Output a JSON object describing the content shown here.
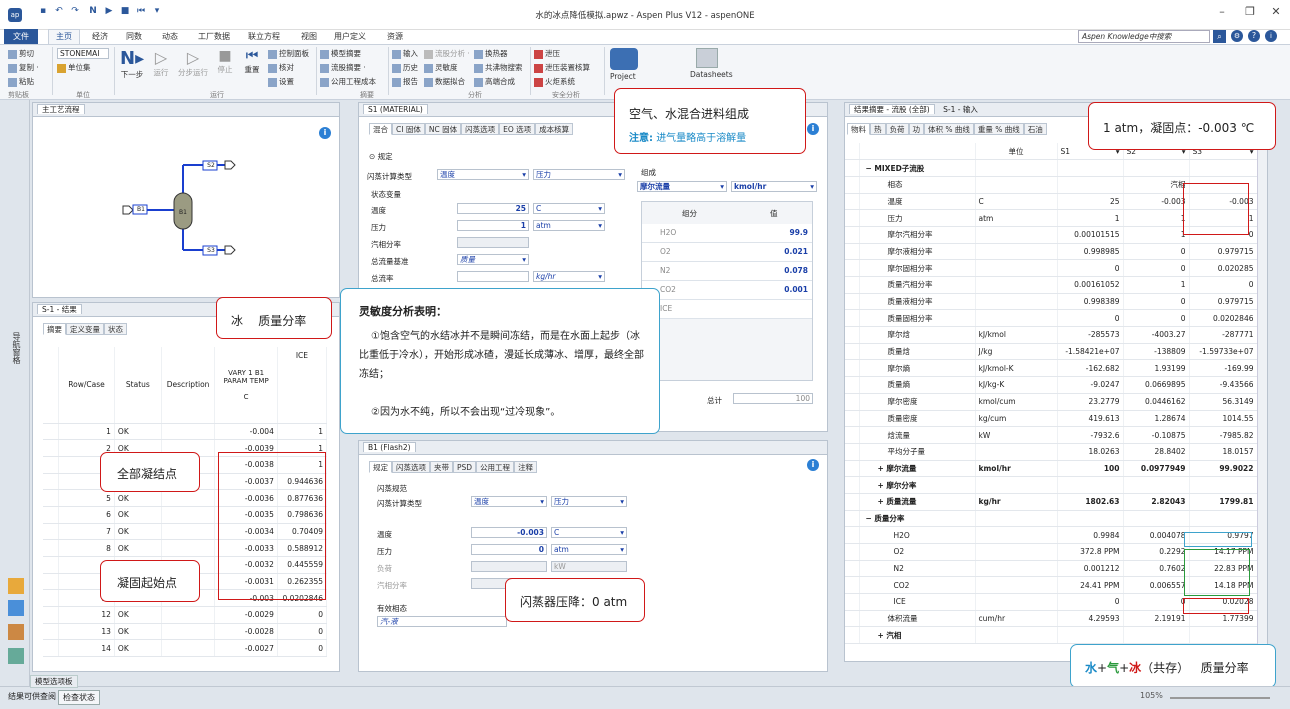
{
  "window": {
    "title": "水的冰点降低模拟.apwz - Aspen Plus V12 - aspenONE"
  },
  "menu": {
    "items": [
      "文件",
      "主页",
      "经济",
      "同数",
      "动态",
      "工厂数据",
      "联立方程",
      "视图",
      "用户定义",
      "资源"
    ],
    "search_placeholder": "Aspen Knowledge中搜索"
  },
  "ribbon": {
    "clipboard": {
      "cut": "剪切",
      "copy": "复制 ·",
      "paste": "粘贴",
      "label": "剪贴板"
    },
    "units": {
      "unit_set": "STONEMAI",
      "unit_btn": "单位集",
      "label": "单位"
    },
    "run": {
      "next": "下一步",
      "run": "运行",
      "step": "分步运行",
      "stop": "停止",
      "reset": "重置",
      "label": "运行"
    },
    "control": {
      "panel": "控制面板",
      "check": "核对",
      "settings": "设置"
    },
    "summary": {
      "model": "模型摘要",
      "stream": "流股摘要 ·",
      "utility": "公用工程成本",
      "label": "摘要"
    },
    "analysis": {
      "input": "输入",
      "history": "历史",
      "report": "报告",
      "stream_analysis": "流股分析 ·",
      "sensitivity": "灵敏度",
      "data_fit": "数据拟合",
      "hx": "换热器",
      "azeo": "共沸物搜索",
      "hydrate": "高端合成",
      "label": "分析"
    },
    "safety": {
      "relief": "泄压",
      "relief_check": "泄压装置核算",
      "flare": "火炬系统",
      "label": "安全分析"
    },
    "project": "Project",
    "datasheets": "Datasheets"
  },
  "flowsheet": {
    "tab": "主工艺流程",
    "streams": {
      "s1": "B1",
      "s2": "S2",
      "s3": "S3",
      "block": "B1"
    }
  },
  "sens": {
    "tab": "S-1 - 结果",
    "subtabs": [
      "摘要",
      "定义变量",
      "状态"
    ],
    "headers": {
      "row": "Row/Case",
      "status": "Status",
      "desc": "Description",
      "vary": "VARY 1 B1 PARAM TEMP",
      "vary_unit": "C",
      "ice": "ICE"
    },
    "rows": [
      {
        "n": "1",
        "s": "OK",
        "t": "-0.004",
        "ice": "1"
      },
      {
        "n": "2",
        "s": "OK",
        "t": "-0.0039",
        "ice": "1"
      },
      {
        "n": "3",
        "s": "OK",
        "t": "-0.0038",
        "ice": "1"
      },
      {
        "n": "4",
        "s": "OK",
        "t": "-0.0037",
        "ice": "0.944636"
      },
      {
        "n": "5",
        "s": "OK",
        "t": "-0.0036",
        "ice": "0.877636"
      },
      {
        "n": "6",
        "s": "OK",
        "t": "-0.0035",
        "ice": "0.798636"
      },
      {
        "n": "7",
        "s": "OK",
        "t": "-0.0034",
        "ice": "0.70409"
      },
      {
        "n": "8",
        "s": "OK",
        "t": "-0.0033",
        "ice": "0.588912"
      },
      {
        "n": "9",
        "s": "OK",
        "t": "-0.0032",
        "ice": "0.445559"
      },
      {
        "n": "10",
        "s": "OK",
        "t": "-0.0031",
        "ice": "0.262355"
      },
      {
        "n": "11",
        "s": "OK",
        "t": "-0.003",
        "ice": "0.0202846"
      },
      {
        "n": "12",
        "s": "OK",
        "t": "-0.0029",
        "ice": "0"
      },
      {
        "n": "13",
        "s": "OK",
        "t": "-0.0028",
        "ice": "0"
      },
      {
        "n": "14",
        "s": "OK",
        "t": "-0.0027",
        "ice": "0"
      }
    ]
  },
  "material": {
    "tab": "S1 (MATERIAL)",
    "subtabs": [
      "混合",
      "CI 固体",
      "NC 固体",
      "闪蒸选项",
      "EO 选项",
      "成本核算"
    ],
    "spec": "规定",
    "flash_type_label": "闪蒸计算类型",
    "flash_type": "温度",
    "flash_type2": "压力",
    "state_vars": "状态变量",
    "temp_label": "温度",
    "temp": "25",
    "temp_unit": "C",
    "pres_label": "压力",
    "pres": "1",
    "pres_unit": "atm",
    "vf_label": "汽相分率",
    "basis_label": "总流量基准",
    "basis": "质量",
    "rate_label": "总流率",
    "rate_unit": "kg/hr",
    "comp_label": "组成",
    "comp_basis": "摩尔流量",
    "comp_unit": "kmol/hr",
    "comp_hdr1": "组分",
    "comp_hdr2": "值",
    "comps": [
      {
        "c": "H2O",
        "v": "99.9"
      },
      {
        "c": "O2",
        "v": "0.021"
      },
      {
        "c": "N2",
        "v": "0.078"
      },
      {
        "c": "CO2",
        "v": "0.001"
      },
      {
        "c": "ICE",
        "v": ""
      }
    ],
    "total_label": "总计",
    "total": "100"
  },
  "flash": {
    "tab": "B1 (Flash2)",
    "subtabs": [
      "规定",
      "闪蒸选项",
      "夹带",
      "PSD",
      "公用工程",
      "注释"
    ],
    "group": "闪蒸规范",
    "type_label": "闪蒸计算类型",
    "type": "温度",
    "type2": "压力",
    "temp_label": "温度",
    "temp": "-0.003",
    "temp_unit": "C",
    "pres_label": "压力",
    "pres": "0",
    "pres_unit": "atm",
    "duty_label": "负荷",
    "duty_unit": "kW",
    "vf_label": "汽相分率",
    "phase_group": "有效相态",
    "phase": "汽-液"
  },
  "results": {
    "tab1": "结果摘要 - 流股 (全部)",
    "tab2": "S-1 - 输入",
    "subtabs": [
      "物料",
      "热",
      "负荷",
      "功",
      "体积 % 曲线",
      "重量 % 曲线",
      "石油"
    ],
    "col_unit": "单位",
    "cols": [
      "S1",
      "S2",
      "S3"
    ],
    "rows": [
      {
        "l": "MIXED子流股",
        "u": "",
        "a": "",
        "b": "",
        "c": "",
        "k": "sec"
      },
      {
        "l": "相态",
        "u": "",
        "a": "",
        "b": "汽相",
        "c": "",
        "k": "n"
      },
      {
        "l": "温度",
        "u": "C",
        "a": "25",
        "b": "-0.003",
        "c": "-0.003",
        "k": "n"
      },
      {
        "l": "压力",
        "u": "atm",
        "a": "1",
        "b": "1",
        "c": "1",
        "k": "n"
      },
      {
        "l": "摩尔汽相分率",
        "u": "",
        "a": "0.00101515",
        "b": "1",
        "c": "0",
        "k": "n"
      },
      {
        "l": "摩尔液相分率",
        "u": "",
        "a": "0.998985",
        "b": "0",
        "c": "0.979715",
        "k": "n"
      },
      {
        "l": "摩尔固相分率",
        "u": "",
        "a": "0",
        "b": "0",
        "c": "0.020285",
        "k": "n"
      },
      {
        "l": "质量汽相分率",
        "u": "",
        "a": "0.00161052",
        "b": "1",
        "c": "0",
        "k": "n"
      },
      {
        "l": "质量液相分率",
        "u": "",
        "a": "0.998389",
        "b": "0",
        "c": "0.979715",
        "k": "n"
      },
      {
        "l": "质量固相分率",
        "u": "",
        "a": "0",
        "b": "0",
        "c": "0.0202846",
        "k": "n"
      },
      {
        "l": "摩尔焓",
        "u": "kJ/kmol",
        "a": "-285573",
        "b": "-4003.27",
        "c": "-287771",
        "k": "n"
      },
      {
        "l": "质量焓",
        "u": "J/kg",
        "a": "-1.58421e+07",
        "b": "-138809",
        "c": "-1.59733e+07",
        "k": "n"
      },
      {
        "l": "摩尔熵",
        "u": "kJ/kmol-K",
        "a": "-162.682",
        "b": "1.93199",
        "c": "-169.99",
        "k": "n"
      },
      {
        "l": "质量熵",
        "u": "kJ/kg-K",
        "a": "-9.0247",
        "b": "0.0669895",
        "c": "-9.43566",
        "k": "n"
      },
      {
        "l": "摩尔密度",
        "u": "kmol/cum",
        "a": "23.2779",
        "b": "0.0446162",
        "c": "56.3149",
        "k": "n"
      },
      {
        "l": "质量密度",
        "u": "kg/cum",
        "a": "419.613",
        "b": "1.28674",
        "c": "1014.55",
        "k": "n"
      },
      {
        "l": "焓流量",
        "u": "kW",
        "a": "-7932.6",
        "b": "-0.10875",
        "c": "-7985.82",
        "k": "n"
      },
      {
        "l": "平均分子量",
        "u": "",
        "a": "18.0263",
        "b": "28.8402",
        "c": "18.0157",
        "k": "n"
      },
      {
        "l": "摩尔流量",
        "u": "kmol/hr",
        "a": "100",
        "b": "0.0977949",
        "c": "99.9022",
        "k": "b"
      },
      {
        "l": "摩尔分率",
        "u": "",
        "a": "",
        "b": "",
        "c": "",
        "k": "b"
      },
      {
        "l": "质量流量",
        "u": "kg/hr",
        "a": "1802.63",
        "b": "2.82043",
        "c": "1799.81",
        "k": "b"
      },
      {
        "l": "质量分率",
        "u": "",
        "a": "",
        "b": "",
        "c": "",
        "k": "sec"
      },
      {
        "l": "H2O",
        "u": "",
        "a": "0.9984",
        "b": "0.004078",
        "c": "0.9797",
        "k": "c"
      },
      {
        "l": "O2",
        "u": "",
        "a": "372.8 PPM",
        "b": "0.2292",
        "c": "14.17 PPM",
        "k": "c"
      },
      {
        "l": "N2",
        "u": "",
        "a": "0.001212",
        "b": "0.7602",
        "c": "22.83 PPM",
        "k": "c"
      },
      {
        "l": "CO2",
        "u": "",
        "a": "24.41 PPM",
        "b": "0.006557",
        "c": "14.18 PPM",
        "k": "c"
      },
      {
        "l": "ICE",
        "u": "",
        "a": "0",
        "b": "0",
        "c": "0.02028",
        "k": "c"
      },
      {
        "l": "体积流量",
        "u": "cum/hr",
        "a": "4.29593",
        "b": "2.19191",
        "c": "1.77399",
        "k": "n"
      },
      {
        "l": "汽相",
        "u": "",
        "a": "",
        "b": "",
        "c": "",
        "k": "b"
      }
    ]
  },
  "callouts": {
    "feed_title": "空气、水混合进料组成",
    "feed_note_label": "注意:",
    "feed_note": "进气量略高于溶解量",
    "ice_mass": "冰    质量分率",
    "freeze_point": "1 atm，凝固点：-0.003 ℃",
    "sens_title": "灵敏度分析表明：",
    "sens_line1": "①饱含空气的水结冰并不是瞬间冻结，而是在水面上起步（冰比重低于冷水），开始形成冰碴，漫延长成薄冰、增厚，最终全部冻结；",
    "sens_line2": "②因为水不纯，所以不会出现“过冷现象”。",
    "full_freeze": "全部凝结点",
    "freeze_start": "凝固起始点",
    "flash_pres": "闪蒸器压降：0 atm",
    "coexist_water": "水",
    "coexist_plus1": "+",
    "coexist_gas": "气",
    "coexist_plus2": "+",
    "coexist_ice": "冰",
    "coexist_tail": "（共存）   质量分率"
  },
  "status": {
    "left": "结果可供查阅",
    "btn": "检查状态",
    "model_tab": "模型选项板",
    "zoom": "105%",
    "nav": "导航窗格"
  },
  "colors": {
    "accent": "#2b579a",
    "callout_red": "#d01818",
    "callout_blue": "#3ea3cc",
    "green": "#2a9a3c"
  }
}
